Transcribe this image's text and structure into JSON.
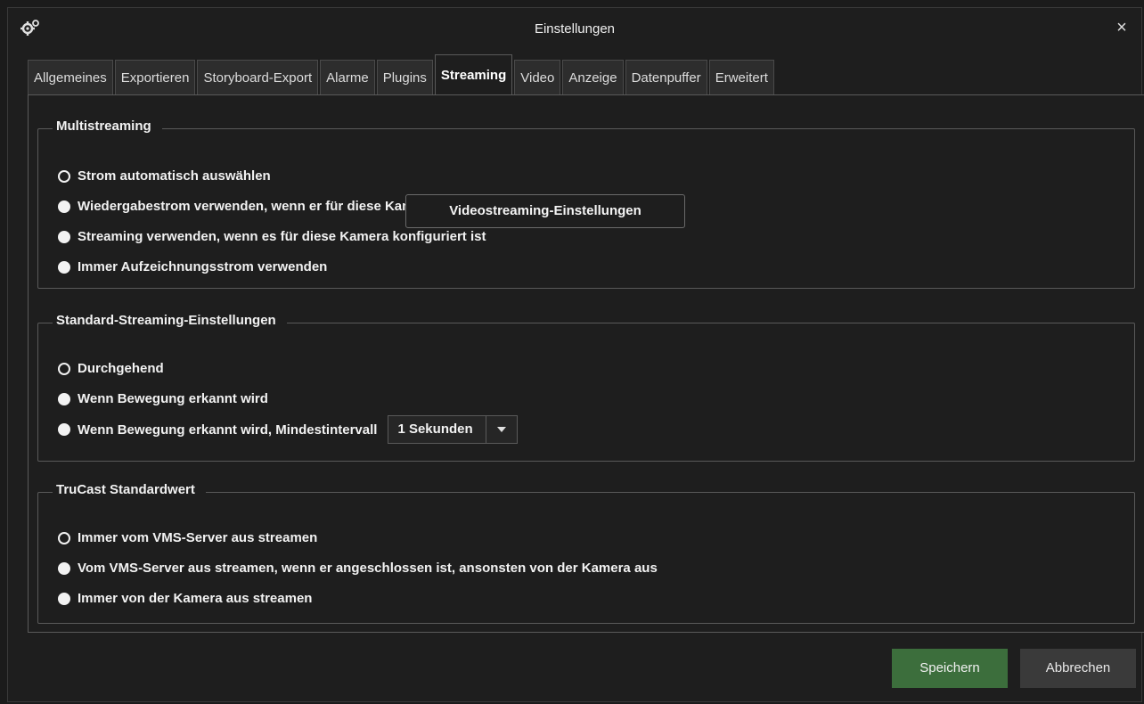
{
  "window": {
    "title": "Einstellungen",
    "app_icon": "gear-icon",
    "close_label": "×"
  },
  "tabs": [
    {
      "label": "Allgemeines",
      "active": false
    },
    {
      "label": "Exportieren",
      "active": false
    },
    {
      "label": "Storyboard-Export",
      "active": false
    },
    {
      "label": "Alarme",
      "active": false
    },
    {
      "label": "Plugins",
      "active": false
    },
    {
      "label": "Streaming",
      "active": true
    },
    {
      "label": "Video",
      "active": false
    },
    {
      "label": "Anzeige",
      "active": false
    },
    {
      "label": "Datenpuffer",
      "active": false
    },
    {
      "label": "Erweitert",
      "active": false
    }
  ],
  "multistreaming": {
    "legend": "Multistreaming",
    "options": [
      {
        "label": "Strom automatisch auswählen",
        "selected": true
      },
      {
        "label": "Wiedergabestrom verwenden, wenn er für diese Kamera konfiguriert ist",
        "selected": false
      },
      {
        "label": "Streaming verwenden, wenn es für diese Kamera konfiguriert ist",
        "selected": false
      },
      {
        "label": "Immer Aufzeichnungsstrom verwenden",
        "selected": false
      }
    ]
  },
  "tooltip": {
    "text": "Videostreaming-Einstellungen"
  },
  "standard_streaming": {
    "legend": "Standard-Streaming-Einstellungen",
    "options": [
      {
        "label": "Durchgehend",
        "selected": true
      },
      {
        "label": "Wenn Bewegung erkannt wird",
        "selected": false
      },
      {
        "label": "Wenn Bewegung erkannt wird, Mindestintervall",
        "selected": false
      }
    ],
    "interval_select": {
      "value": "1 Sekunden"
    }
  },
  "trucast": {
    "legend": "TruCast Standardwert",
    "options": [
      {
        "label": "Immer vom VMS-Server aus streamen",
        "selected": true
      },
      {
        "label": "Vom VMS-Server aus streamen, wenn er angeschlossen ist, ansonsten von der Kamera aus",
        "selected": false
      },
      {
        "label": "Immer von der Kamera aus streamen",
        "selected": false
      }
    ]
  },
  "buttons": {
    "save": "Speichern",
    "cancel": "Abbrechen"
  },
  "colors": {
    "background": "#1e1e1e",
    "save_button": "#3c6e3c",
    "cancel_button": "#3a3a3a",
    "border": "#5a5a5a"
  }
}
